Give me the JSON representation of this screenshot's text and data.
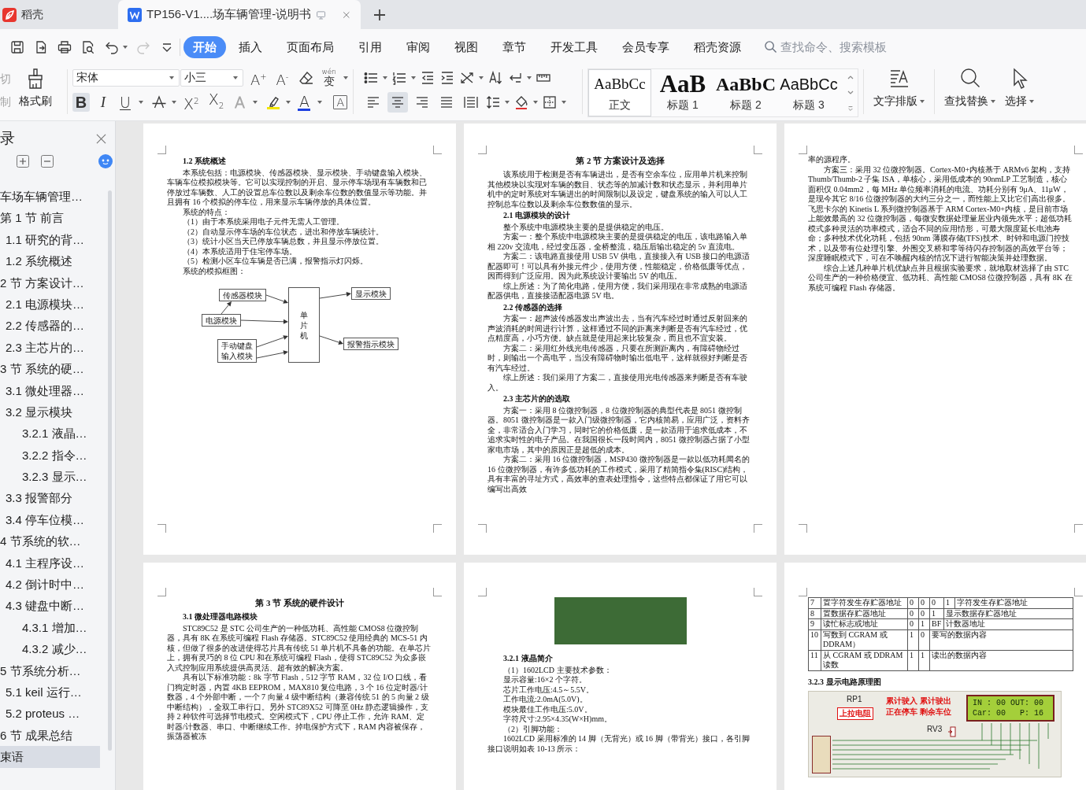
{
  "tabs": [
    {
      "label": "稻壳",
      "kind": "home",
      "selected": false
    },
    {
      "label": "TP156-V1....场车辆管理-说明书",
      "kind": "document",
      "selected": true
    }
  ],
  "quick_access": {
    "redo_disabled": true
  },
  "menu_tabs": [
    {
      "label": "开始",
      "selected": true
    },
    {
      "label": "插入",
      "selected": false
    },
    {
      "label": "页面布局",
      "selected": false
    },
    {
      "label": "引用",
      "selected": false
    },
    {
      "label": "审阅",
      "selected": false
    },
    {
      "label": "视图",
      "selected": false
    },
    {
      "label": "章节",
      "selected": false
    },
    {
      "label": "开发工具",
      "selected": false
    },
    {
      "label": "会员专享",
      "selected": false
    },
    {
      "label": "稻壳资源",
      "selected": false
    }
  ],
  "search": {
    "placeholder": "查找命令、搜索模板"
  },
  "ribbon": {
    "clipboard": {
      "buttons": [
        {
          "label": "切",
          "disabled": true
        },
        {
          "label": "制",
          "disabled": true
        }
      ],
      "format_painter": "格式刷"
    },
    "font": {
      "name": "宋体",
      "size": "小三",
      "size_buttons": [
        {
          "label": "A$^{+}$"
        },
        {
          "label": "A$^{-}$"
        }
      ],
      "pinyin": {
        "ruby": "wén",
        "label": "变"
      },
      "buttons": [
        {
          "label": "B",
          "kind": "bold",
          "selected": true
        },
        {
          "label": "I",
          "kind": "italic",
          "selected": false
        },
        {
          "label": "U",
          "kind": "underline",
          "selected": false
        },
        {
          "label": "X$^{2}$",
          "kind": "superscript",
          "selected": false
        },
        {
          "label": "X$_{2}$",
          "kind": "subscript",
          "selected": false
        },
        {
          "label": "A",
          "kind": "effect",
          "selected": false
        },
        {
          "label": "A",
          "kind": "color",
          "selected": false
        },
        {
          "label": "A",
          "kind": "boxed",
          "selected": false
        }
      ]
    },
    "paragraph": {
      "align": [
        {
          "kind": "left",
          "selected": false
        },
        {
          "kind": "center",
          "selected": true
        },
        {
          "kind": "right",
          "selected": false
        },
        {
          "kind": "justify",
          "selected": false
        },
        {
          "kind": "distributed",
          "selected": false
        }
      ]
    },
    "styles": [
      {
        "sample": "AaBbCc",
        "label": "正文",
        "kind": "body",
        "selected": true
      },
      {
        "sample": "AaB",
        "label": "标题 1",
        "kind": "h1",
        "selected": false
      },
      {
        "sample": "AaBbC",
        "label": "标题 2",
        "kind": "h2",
        "selected": false
      },
      {
        "sample": "AaBbCc",
        "label": "标题 3",
        "kind": "h3",
        "selected": false
      }
    ],
    "tools": [
      {
        "label": "文字排版",
        "kind": "layout"
      },
      {
        "label": "查找替换",
        "kind": "find"
      },
      {
        "label": "选择",
        "kind": "select"
      }
    ]
  },
  "outline": {
    "title": "录",
    "items": [
      {
        "label": "车场车辆管理…",
        "selected": false
      },
      {
        "label": "第 1 节 前言",
        "selected": false,
        "children": [
          {
            "label": "1.1 研究的背…",
            "selected": false
          },
          {
            "label": "1.2 系统概述",
            "selected": false
          }
        ]
      },
      {
        "label": "2 节 方案设计…",
        "selected": false,
        "children": [
          {
            "label": "2.1 电源模块…",
            "selected": false
          },
          {
            "label": "2.2 传感器的…",
            "selected": false
          },
          {
            "label": "2.3 主芯片的…",
            "selected": false
          }
        ]
      },
      {
        "label": "3 节 系统的硬…",
        "selected": false,
        "children": [
          {
            "label": "3.1 微处理器…",
            "selected": false
          },
          {
            "label": "3.2 显示模块",
            "selected": false,
            "children": [
              {
                "label": "3.2.1 液晶…",
                "selected": false
              },
              {
                "label": "3.2.2 指令…",
                "selected": false
              },
              {
                "label": "3.2.3 显示…",
                "selected": false
              }
            ]
          },
          {
            "label": "3.3 报警部分",
            "selected": false
          },
          {
            "label": "3.4 停车位模…",
            "selected": false
          }
        ]
      },
      {
        "label": "4 节系统的软…",
        "selected": false,
        "children": [
          {
            "label": "4.1 主程序设…",
            "selected": false
          },
          {
            "label": "4.2 倒计时中…",
            "selected": false
          },
          {
            "label": "4.3 键盘中断…",
            "selected": false,
            "children": [
              {
                "label": "4.3.1 增加…",
                "selected": false
              },
              {
                "label": "4.3.2 减少…",
                "selected": false
              }
            ]
          }
        ]
      },
      {
        "label": "5 节系统分析…",
        "selected": false,
        "children": [
          {
            "label": "5.1 keil 运行…",
            "selected": false
          },
          {
            "label": "5.2 proteus …",
            "selected": false
          }
        ]
      },
      {
        "label": "6 节 成果总结",
        "selected": false
      },
      {
        "label": "束语",
        "selected": true
      }
    ]
  },
  "pages": [
    {
      "blocks": [
        {
          "kind": "heading",
          "text": "1.2 系统概述"
        },
        {
          "kind": "para",
          "text": "本系统包括：电源模块、传感器模块、显示模块、手动键盘输入模块、车辆车位模拟模块等。它可以实现控制的开启、显示停车场现有车辆数和已停放过车辆数、人工的设置总车位数以及剩余车位数的数值显示等功能。并且拥有 16 个模拟的停车位，用来显示车辆停放的具体位置。"
        },
        {
          "kind": "para",
          "text": "系统的特点："
        },
        {
          "kind": "para",
          "text": "（1）由于本系统采用电子元件无需人工管理。"
        },
        {
          "kind": "para",
          "text": "（2）自动显示停车场的车位状态，进出和停放车辆统计。"
        },
        {
          "kind": "para",
          "text": "（3）统计小区当天已停放车辆总数，并且显示停放位置。"
        },
        {
          "kind": "para",
          "text": "（4）本系统适用于住宅停车场。"
        },
        {
          "kind": "para",
          "text": "（5）检测小区车位车辆是否已满，报警指示灯闪烁。"
        },
        {
          "kind": "para",
          "text": "系统的模拟框图："
        },
        {
          "kind": "diagram",
          "nodes": [
            {
              "label": "传感器模块"
            },
            {
              "label": "电源模块"
            },
            {
              "label": "手动键盘输入模块"
            },
            {
              "label": "单片机"
            },
            {
              "label": "显示模块"
            },
            {
              "label": "报警指示模块"
            }
          ]
        }
      ]
    },
    {
      "blocks": [
        {
          "kind": "title",
          "text": "第 2 节 方案设计及选择"
        },
        {
          "kind": "para",
          "text": "该系统用于检测是否有车辆进出，是否有空余车位，应用单片机来控制其他模块以实现对车辆的数目、状态等的加减计数和状态显示，并利用单片机中的定时系统对车辆进出的时间限制以及设定，键盘系统的输入可以人工控制总车位数以及剩余车位数数值的显示。"
        },
        {
          "kind": "heading",
          "text": "2.1 电源模块的设计"
        },
        {
          "kind": "para",
          "text": "整个系统中电源模块主要的是提供稳定的电压。"
        },
        {
          "kind": "para",
          "text": "方案一：整个系统中电源模块主要的是提供稳定的电压，该电路输入单相 220v 交流电，经过变压器，全桥整流，稳压后输出稳定的 5v 直流电。"
        },
        {
          "kind": "para",
          "text": "方案二：该电路直接使用 USB 5V 供电，直接接入有 USB 接口的电源适配器即可！可以具有外接元件少，使用方便，性能稳定，价格低廉等优点，因而得到广泛应用。因为此系统设计要输出 5V 的电压。"
        },
        {
          "kind": "para",
          "text": "综上所述：为了简化电路，使用方便，我们采用现在非常成熟的电源适配器供电，直接接适配器电源 5V 电。"
        },
        {
          "kind": "heading",
          "text": "2.2 传感器的选择"
        },
        {
          "kind": "para",
          "text": "方案一：超声波传感器发出声波出去，当有汽车经过时通过反射回来的声波消耗的时间进行计算，这样通过不同的距离来判断是否有汽车经过，优点精度高，小巧方便。缺点就是使用起来比较复杂，而且也不宜安装。"
        },
        {
          "kind": "para",
          "text": "方案二：采用红外线光电传感器，只要在所测距离内，有障碍物经过时，则输出一个高电平，当没有障碍物时输出低电平，这样就很好判断是否有汽车经过。"
        },
        {
          "kind": "para",
          "text": "综上所述：我们采用了方案二，直接使用光电传感器来判断是否有车驶入。"
        },
        {
          "kind": "heading",
          "text": "2.3 主芯片的的选取"
        },
        {
          "kind": "para",
          "text": "方案一：采用 8 位微控制器，8 位微控制器的典型代表是 8051 微控制器。8051 微控制器是一款入门级微控制器，它内核简易，应用广泛，资料齐全，非常适合入门学习，同时它的价格低廉，是一款适用于追求低成本，不追求实时性的电子产品。在我国很长一段时间内，8051 微控制器占据了小型家电市场，其中的原因正是超低的成本。"
        },
        {
          "kind": "para",
          "text": "方案二：采用 16 位微控制器，MSP430 微控制器是一款以低功耗闻名的 16 位微控制器，有许多低功耗的工作模式，采用了精简指令集(RISC)结构，具有丰富的寻址方式，高效率的查表处理指令，这些特点都保证了用它可以编写出高效"
        }
      ]
    },
    {
      "blocks": [
        {
          "kind": "plain",
          "text": "率的源程序。"
        },
        {
          "kind": "para",
          "text": "方案三：采用 32 位微控制器。Cortex-M0+内核基于 ARMv6 架构，支持 Thumb/Thumb-2 子集 ISA，单核心，采用低成本的 90nmLP 工艺制造，核心面积仅 0.04mm2，每 MHz 单位频率消耗的电流、功耗分别有 9μA、11μW，是现今其它 8/16 位微控制器的大约三分之一，而性能上又比它们高出很多。飞思卡尔的 Kinetis L 系列微控制器基于 ARM Cortex-M0+内核，是目前市场上能效最高的 32 位微控制器，每微安数据处理量居业内领先水平；超低功耗模式多种灵活的功率模式，适合不同的应用情形，可最大限度延长电池寿命；多种技术优化功耗，包括 90nm 薄膜存储(TFS)技术、时钟和电源门控技术，以及带有位处理引擎、外围交叉桥和零等待闪存控制器的高效平台等；深度睡眠模式下，可在不唤醒内核的情况下进行智能决策并处理数据。"
        },
        {
          "kind": "para",
          "text": "综合上述几种单片机优缺点并且根据实验要求，就地取材选择了由 STC 公司生产的一种价格便宜、低功耗、高性能 CMOS8 位微控制器，具有 8K 在系统可编程 Flash 存储器。"
        }
      ]
    },
    {
      "blocks": [
        {
          "kind": "title",
          "text": "第 3 节 系统的硬件设计"
        },
        {
          "kind": "heading",
          "text": "3.1 微处理器电路模块"
        },
        {
          "kind": "para",
          "text": "STC89C52 是 STC 公司生产的一种低功耗、高性能 CMOS8 位微控制器，具有 8K 在系统可编程 Flash 存储器。STC89C52 使用经典的 MCS-51 内核，但做了很多的改进使得芯片具有传统 51 单片机不具备的功能。在单芯片上，拥有灵巧的 8 位 CPU 和在系统可编程 Flash，使得 STC89C52 为众多嵌入式控制应用系统提供高灵活、超有效的解决方案。"
        },
        {
          "kind": "para",
          "text": "具有以下标准功能：8k 字节 Flash，512 字节 RAM，32 位 I/O 口线，看门狗定时器，内置 4KB EEPROM，MAX810 复位电路，3 个 16 位定时器/计数器，4 个外部中断，一个 7 向量 4 级中断结构（兼容传统 51 的 5 向量 2 级中断结构），全双工串行口。另外 STC89X52 可降至 0Hz 静态逻辑操作，支持 2 种软件可选择节电模式。空闲模式下，CPU 停止工作，允许 RAM、定时器/计数器、串口、中断继续工作。掉电保护方式下，RAM 内容被保存，振荡器被冻"
        }
      ]
    },
    {
      "blocks": [
        {
          "kind": "photo"
        },
        {
          "kind": "heading",
          "text": "3.2.1 液晶简介"
        },
        {
          "kind": "para",
          "text": "（1）1602LCD 主要技术参数："
        },
        {
          "kind": "para",
          "text": "显示容量:16×2 个字符。"
        },
        {
          "kind": "para",
          "text": "芯片工作电压:4.5～5.5V。"
        },
        {
          "kind": "para",
          "text": "工作电流:2.0mA(5.0V)。"
        },
        {
          "kind": "para",
          "text": "模块最佳工作电压:5.0V。"
        },
        {
          "kind": "para",
          "text": "字符尺寸:2.95×4.35(W×H)mm。"
        },
        {
          "kind": "para",
          "text": "（2）引脚功能："
        },
        {
          "kind": "para",
          "text": "1602LCD 采用标准的 14 脚（无背光）或 16 脚（带背光）接口，各引脚接口说明如表 10-13 所示："
        }
      ]
    },
    {
      "blocks": [
        {
          "kind": "table",
          "rows": [
            {
              "cells": [
                "7",
                "置字符发生存贮器地址",
                "0",
                "0",
                "0",
                "1",
                "字符发生存贮器地址"
              ]
            },
            {
              "cells": [
                "8",
                "置数据存贮器地址",
                "0",
                "0",
                "1",
                "显示数据存贮器地址"
              ]
            },
            {
              "cells": [
                "9",
                "读忙标志或地址",
                "0",
                "1",
                "BF",
                "计数器地址"
              ]
            },
            {
              "cells": [
                "10",
                "写数到 CGRAM 或 DDRAM）",
                "1",
                "0",
                "要写的数据内容"
              ]
            },
            {
              "cells": [
                "11",
                "从 CGRAM 或 DDRAM 读数",
                "1",
                "1",
                "读出的数据内容"
              ]
            }
          ]
        },
        {
          "kind": "subheading",
          "text": "3.2.3 显示电路原理图"
        },
        {
          "kind": "schematic",
          "labels": [
            "RP1",
            "RV3"
          ],
          "tag": "上拉电阻",
          "notes": [
            "累计驶入 累计驶出",
            "正在停车 剩余车位"
          ],
          "lcd_lines": [
            "IN : 00 OUT: 00",
            "Car: 00   P: 16"
          ]
        }
      ]
    }
  ]
}
